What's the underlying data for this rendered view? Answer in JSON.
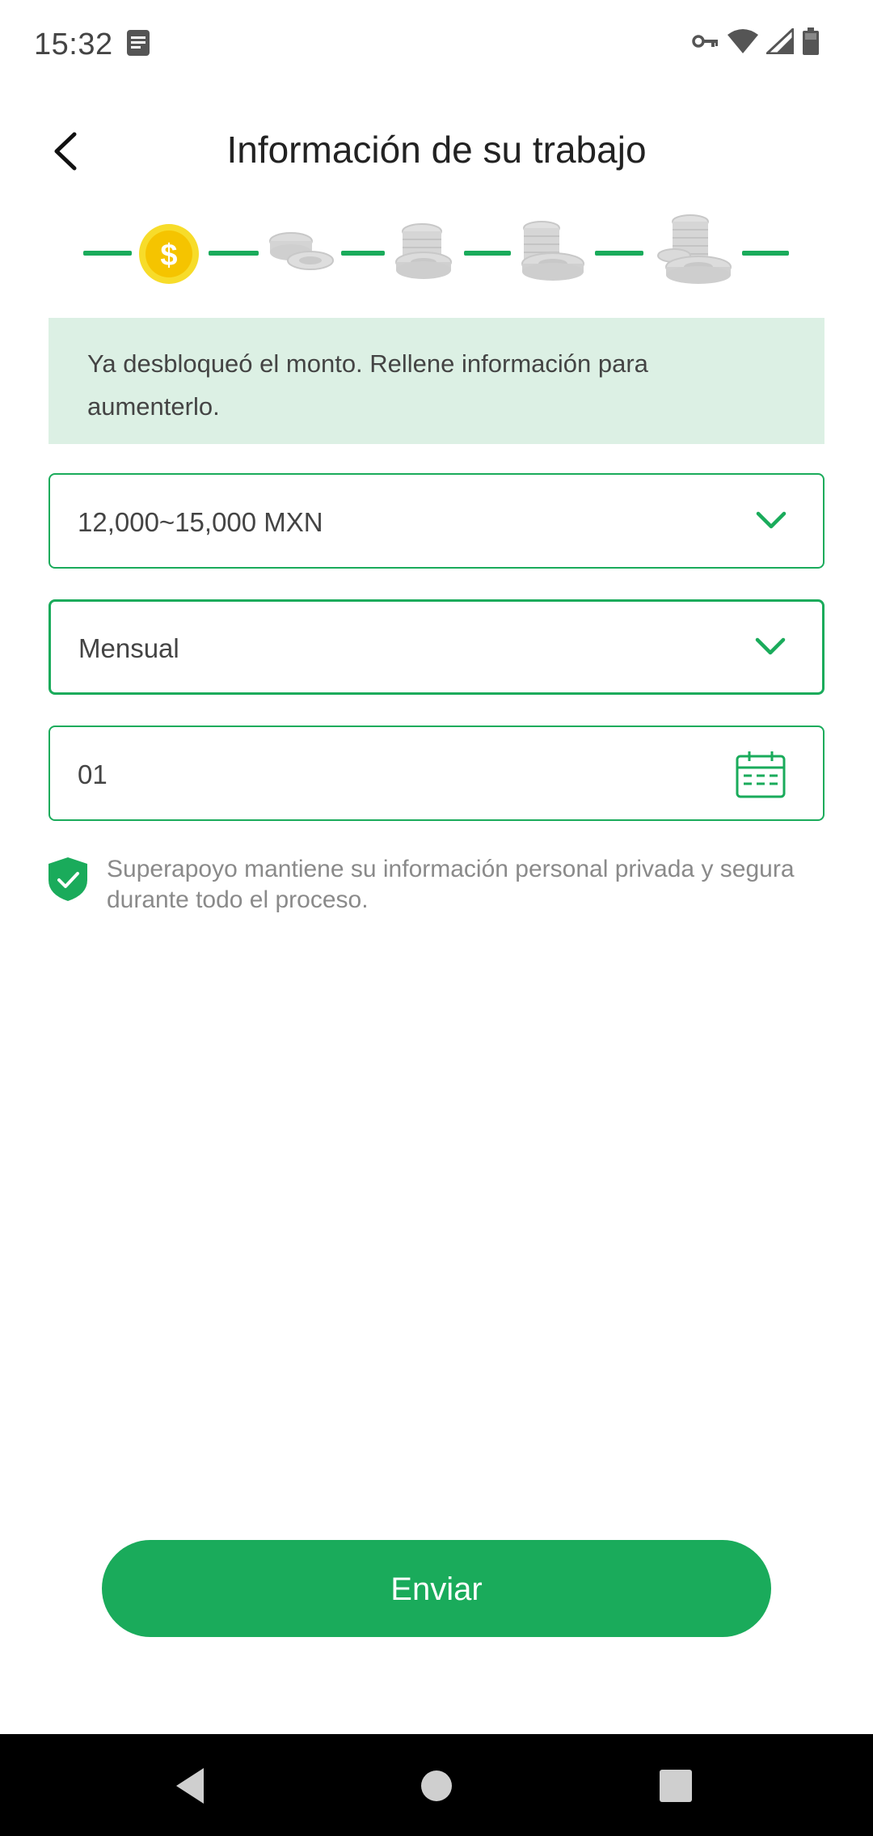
{
  "status_bar": {
    "time": "15:32",
    "left_icon": "notification-document-icon",
    "right_icons": [
      "vpn-key-icon",
      "wifi-icon",
      "cell-signal-icon",
      "battery-icon"
    ]
  },
  "header": {
    "back_icon": "chevron-left-icon",
    "title": "Información de su trabajo"
  },
  "stepper": {
    "current_step": 1,
    "total_steps": 5,
    "colors": {
      "line": "#1aab5b",
      "active_coin": "#f5c800",
      "inactive_coin": "#d6d6d6"
    }
  },
  "banner": {
    "text": "Ya desbloqueó el monto. Rellene información para aumenterlo."
  },
  "form": {
    "income": {
      "value": "12,000~15,000 MXN",
      "icon": "chevron-down-icon"
    },
    "frequency": {
      "value": "Mensual",
      "icon": "chevron-down-icon"
    },
    "pay_day": {
      "value": "01",
      "icon": "calendar-icon"
    }
  },
  "privacy": {
    "icon": "shield-check-icon",
    "text": "Superapoyo mantiene su información personal privada y segura durante todo el proceso."
  },
  "submit": {
    "label": "Enviar"
  },
  "nav": {
    "icons": [
      "back-triangle-icon",
      "home-circle-icon",
      "recents-square-icon"
    ]
  },
  "colors": {
    "accent": "#1aab5b",
    "banner_bg": "#dcf0e4",
    "text": "#444444"
  }
}
